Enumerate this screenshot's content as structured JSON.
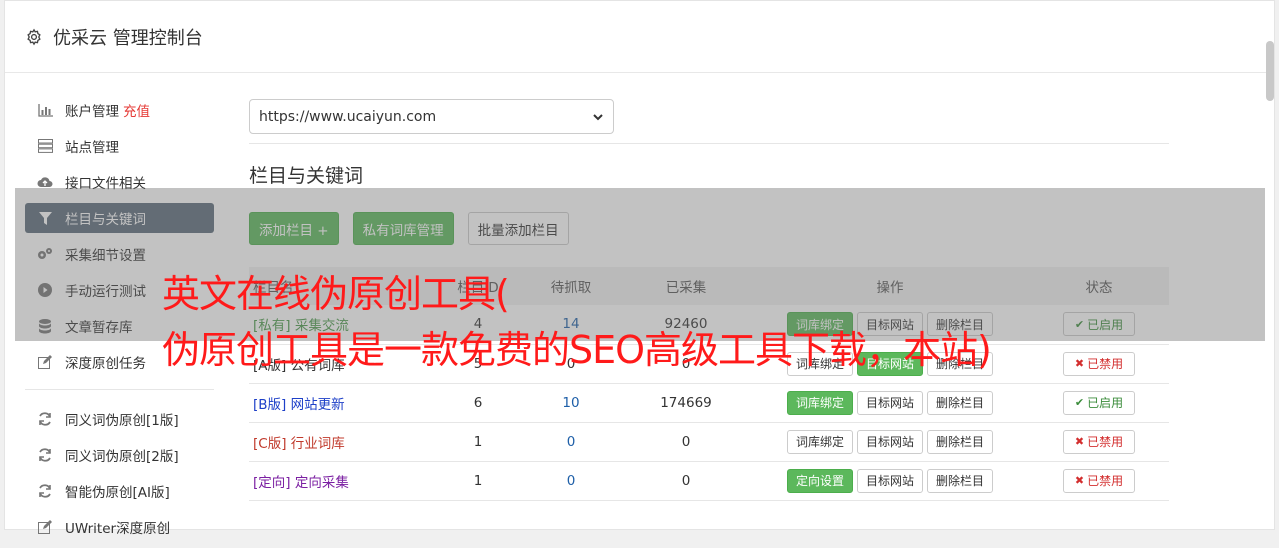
{
  "header": {
    "title": "优采云 管理控制台"
  },
  "sidebar": {
    "items": [
      {
        "label": "账户管理",
        "extra": "充值",
        "icon": "bar-chart-icon"
      },
      {
        "label": "站点管理",
        "icon": "server-icon"
      },
      {
        "label": "接口文件相关",
        "icon": "cloud-upload-icon"
      },
      {
        "label": "栏目与关键词",
        "icon": "filter-icon",
        "active": true
      },
      {
        "label": "采集细节设置",
        "icon": "gears-icon"
      },
      {
        "label": "手动运行测试",
        "icon": "play-icon"
      },
      {
        "label": "文章暂存库",
        "icon": "database-icon"
      },
      {
        "label": "深度原创任务",
        "icon": "edit-icon"
      }
    ],
    "items2": [
      {
        "label": "同义词伪原创[1版]",
        "icon": "refresh-icon"
      },
      {
        "label": "同义词伪原创[2版]",
        "icon": "refresh-icon"
      },
      {
        "label": "智能伪原创[AI版]",
        "icon": "refresh-icon"
      },
      {
        "label": "UWriter深度原创",
        "icon": "edit-icon"
      }
    ]
  },
  "main": {
    "site_select": "https://www.ucaiyun.com",
    "section_title": "栏目与关键词",
    "buttons": {
      "add_column": "添加栏目 +",
      "private_lib": "私有词库管理",
      "batch_add": "批量添加栏目"
    },
    "table": {
      "headers": [
        "栏目名",
        "栏目ID",
        "待抓取",
        "已采集",
        "操作",
        "状态"
      ],
      "rows": [
        {
          "tag": "[私有]",
          "name": "采集交流",
          "id": "4",
          "pending": "14",
          "collected": "92460",
          "op1": "词库绑定",
          "op2": "目标网站",
          "op3": "删除栏目",
          "status": "已启用",
          "enabled": true,
          "tagclass": "tag-private",
          "op1green": true
        },
        {
          "tag": "[A版]",
          "name": "公有词库",
          "id": "5",
          "pending": "0",
          "collected": "0",
          "op1": "词库绑定",
          "op2": "目标网站",
          "op3": "删除栏目",
          "status": "已禁用",
          "enabled": false,
          "tagclass": "tag-a",
          "op1green": false,
          "op2green": true
        },
        {
          "tag": "[B版]",
          "name": "网站更新",
          "id": "6",
          "pending": "10",
          "collected": "174669",
          "op1": "词库绑定",
          "op2": "目标网站",
          "op3": "删除栏目",
          "status": "已启用",
          "enabled": true,
          "tagclass": "tag-b",
          "op1green": true
        },
        {
          "tag": "[C版]",
          "name": "行业词库",
          "id": "1",
          "pending": "0",
          "collected": "0",
          "op1": "词库绑定",
          "op2": "目标网站",
          "op3": "删除栏目",
          "status": "已禁用",
          "enabled": false,
          "tagclass": "tag-c",
          "op1green": false
        },
        {
          "tag": "[定向]",
          "name": "定向采集",
          "id": "1",
          "pending": "0",
          "collected": "0",
          "op1": "定向设置",
          "op2": "目标网站",
          "op3": "删除栏目",
          "status": "已禁用",
          "enabled": false,
          "tagclass": "tag-d",
          "op1green": true
        }
      ]
    }
  },
  "overlay": {
    "line1": "英文在线伪原创工具(",
    "line2": "伪原创工具是一款免费的SEO高级工具下载，本站)"
  },
  "colors": {
    "accent_green": "#5cb85c",
    "active_nav": "#5c6b7a",
    "overlay_red": "#ff1a1a"
  }
}
